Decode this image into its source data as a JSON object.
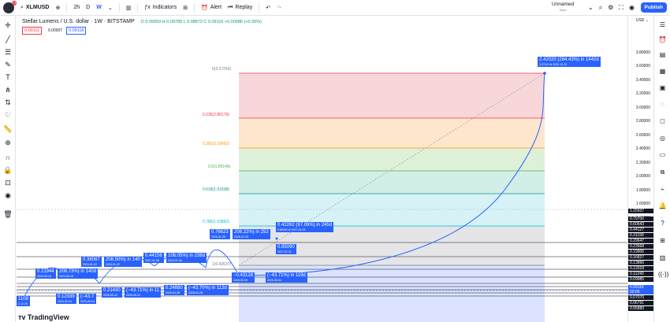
{
  "topbar": {
    "notif_badge": "13",
    "symbol": "XLMUSD",
    "interval": "2h",
    "interval_d": "D",
    "interval_w": "W",
    "indicators": "Indicators",
    "alert": "Alert",
    "replay": "Replay",
    "layout_name": "Unnamed",
    "layout_status": "Save",
    "publish": "Publish"
  },
  "legend": {
    "title": "Stellar Lumens / U.S. dollar · 1W · BITSTAMP",
    "ohlc": "O 0.09059  H 0.09789  L 0.08873  C 0.09116  +0.00086 (+0.95%)",
    "price_sell": "0.09111",
    "spread": "0.00007",
    "price_buy": "0.09118"
  },
  "axis": {
    "currency": "USD",
    "ticks": [
      "3.80000",
      "3.60000",
      "3.40000",
      "3.20000",
      "3.00000",
      "2.80000",
      "2.60000",
      "2.40000",
      "2.20000",
      "2.00000",
      "1.80000",
      "1.60000",
      "1.40000"
    ],
    "tags": [
      {
        "text": "1.25937",
        "color": "#131722"
      },
      {
        "text": "0.79700",
        "color": "#131722"
      },
      {
        "text": "0.60643",
        "color": "#131722"
      },
      {
        "text": "0.44127",
        "color": "#131722"
      },
      {
        "text": "0.31199",
        "color": "#131722"
      },
      {
        "text": "0.29647",
        "color": "#131722"
      },
      {
        "text": "0.23568",
        "color": "#131722"
      },
      {
        "text": "0.19906",
        "color": "#131722"
      },
      {
        "text": "0.16827",
        "color": "#131722"
      },
      {
        "text": "0.13866",
        "color": "#131722"
      },
      {
        "text": "0.12018",
        "color": "#131722"
      },
      {
        "text": "0.11240",
        "color": "#131722"
      },
      {
        "text": "0.09985",
        "color": "#131722"
      },
      {
        "text": "0.09116",
        "color": "#2962ff"
      },
      {
        "text": "00:00",
        "color": "#2962ff"
      },
      {
        "text": "0.07070",
        "color": "#131722"
      },
      {
        "text": "0.06791",
        "color": "#131722"
      },
      {
        "text": "0.05880",
        "color": "#131722"
      }
    ]
  },
  "fib": {
    "levels": [
      {
        "label": "0(3.27254)",
        "color": "#f23645"
      },
      {
        "label": "0.236(2.80179)",
        "color": "#f23645"
      },
      {
        "label": "0.382(2.18663)",
        "color": "#ff9800"
      },
      {
        "label": "0.5(1.85149)",
        "color": "#4caf50"
      },
      {
        "label": "0.618(1.51608)",
        "color": "#089981"
      },
      {
        "label": "0.786(1.03862)",
        "color": "#00bcd4"
      },
      {
        "label": "1(0.43537)",
        "color": "#787b86"
      }
    ]
  },
  "annotations": {
    "target": {
      "main": "2.42020 (284.43%) in 1442d",
      "sub": "3.27110 ⊕ 2030-12-23"
    },
    "a1": {
      "main": "0.42262 (97.09%) in 245d",
      "sub": "0.85090 ⊕ 2027-01-04"
    },
    "a2": {
      "main": "0.85090",
      "sub": "2027-01-11"
    },
    "a3": {
      "main": "−0.43128",
      "sub": "2025-05-05"
    },
    "a4": {
      "main": "(−43.71%) in 119d",
      "sub": "2026-05-04"
    },
    "a5": {
      "main": "0.76623",
      "sub": "2026-01-05"
    },
    "a6": {
      "main": "208.22%) in 252",
      "sub": "2026-01-05"
    },
    "a7": {
      "main": "0.44156",
      "sub": "2027-01-06"
    },
    "a8": {
      "main": "106.05%) in 238d",
      "sub": "2025-01-06"
    },
    "a9": {
      "main": "0.38087",
      "sub": "2024-01-22"
    },
    "a10": {
      "main": "208.50%) in 140",
      "sub": "2024-01-22"
    },
    "a11": {
      "main": "0.21944",
      "sub": "2023-05-15"
    },
    "a12": {
      "main": "208.73%) in 140d",
      "sub": "2023-05-15"
    },
    "a13": {
      "main": "0.12339",
      "sub": "2023-09-04"
    },
    "a14": {
      "main": "(−43.7",
      "sub": "2023-09-04"
    },
    "a15": {
      "main": "0.21430",
      "sub": "2025-05-12"
    },
    "a16": {
      "main": "(−43.71%) in 11",
      "sub": "2025-05-12"
    },
    "a17": {
      "main": "0.24880",
      "sub": "2026-04-28"
    },
    "a18": {
      "main": "(−43.70%) in 112d",
      "sub": "2026-04-28"
    },
    "a19": {
      "main": "1108",
      "sub": "2-12-26"
    },
    "a20": {
      "main": "0.85090",
      "sub": "2027-01-11"
    }
  },
  "brand": "TradingView",
  "colors": {
    "accent": "#2962ff",
    "up": "#089981",
    "down": "#f23645"
  }
}
